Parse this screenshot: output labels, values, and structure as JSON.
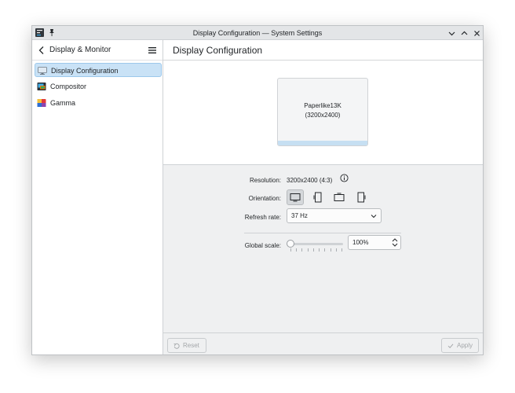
{
  "window": {
    "title": "Display Configuration — System Settings"
  },
  "sidebar": {
    "header": "Display & Monitor",
    "items": [
      {
        "label": "Display Configuration",
        "icon": "display-icon",
        "selected": true
      },
      {
        "label": "Compositor",
        "icon": "compositor-icon",
        "selected": false
      },
      {
        "label": "Gamma",
        "icon": "gamma-icon",
        "selected": false
      }
    ]
  },
  "page": {
    "title": "Display Configuration"
  },
  "monitor": {
    "name": "Paperlike13K",
    "resolution": "(3200x2400)"
  },
  "settings": {
    "resolution_label": "Resolution:",
    "resolution_value": "3200x2400 (4:3)",
    "orientation_label": "Orientation:",
    "orientation_options": [
      "landscape-icon",
      "portrait-icon",
      "landscape-flipped-icon",
      "portrait-flipped-icon"
    ],
    "refresh_label": "Refresh rate:",
    "refresh_value": "37 Hz",
    "scale_label": "Global scale:",
    "scale_value": "100%",
    "scale_slider_fraction": 0
  },
  "footer": {
    "reset_label": "Reset",
    "apply_label": "Apply"
  },
  "colors": {
    "selection": "#c9e2f6",
    "accent": "#3daee9",
    "window_bg": "#eff0f1"
  }
}
